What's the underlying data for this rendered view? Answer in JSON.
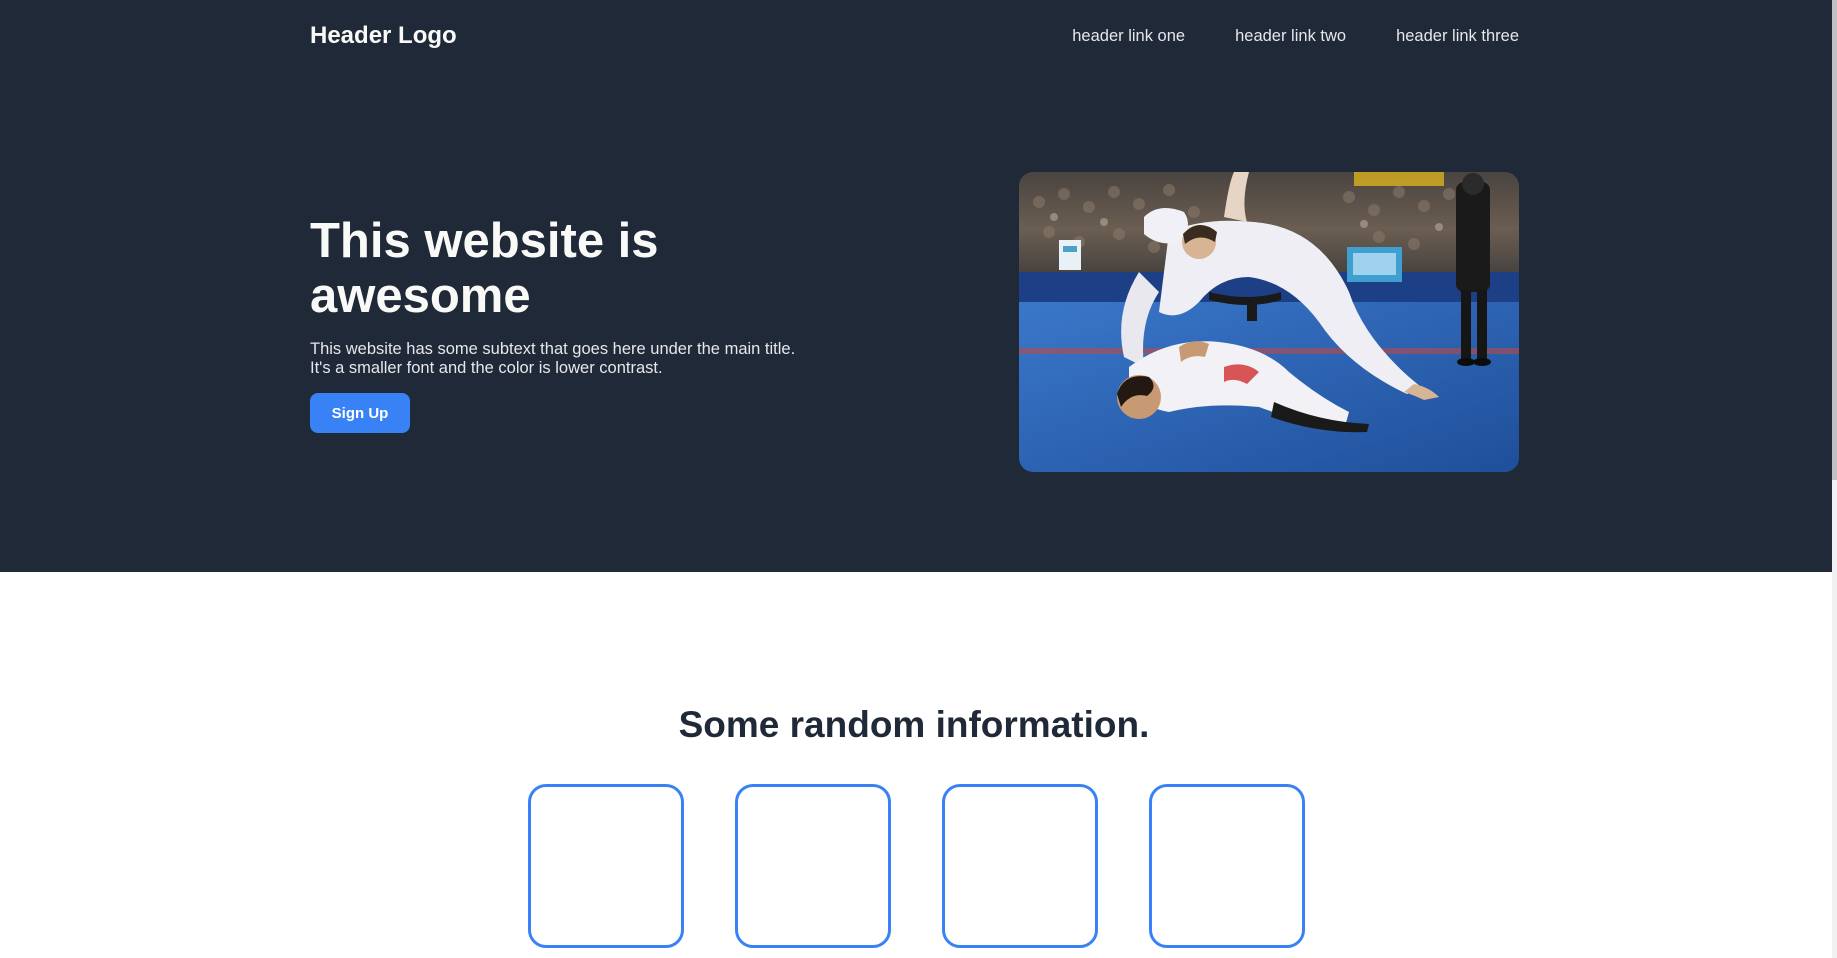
{
  "header": {
    "logo": "Header Logo",
    "nav_links": [
      "header link one",
      "header link two",
      "header link three"
    ]
  },
  "hero": {
    "title": "This website is awesome",
    "subtext": "This website has some subtext that goes here under the main title. It's a smaller font and the color is lower contrast.",
    "button_label": "Sign Up",
    "image": {
      "alt": "Two jiu-jitsu athletes in white gis grappling on a blue mat in a crowded arena, with a referee standing nearby"
    }
  },
  "info": {
    "title": "Some random information.",
    "card_count": 4
  },
  "colors": {
    "hero_background": "#1f2937",
    "accent": "#3882f6",
    "heading_light": "#f9faf8",
    "text_muted_light": "#e5e7eb",
    "heading_dark": "#1f2937"
  }
}
